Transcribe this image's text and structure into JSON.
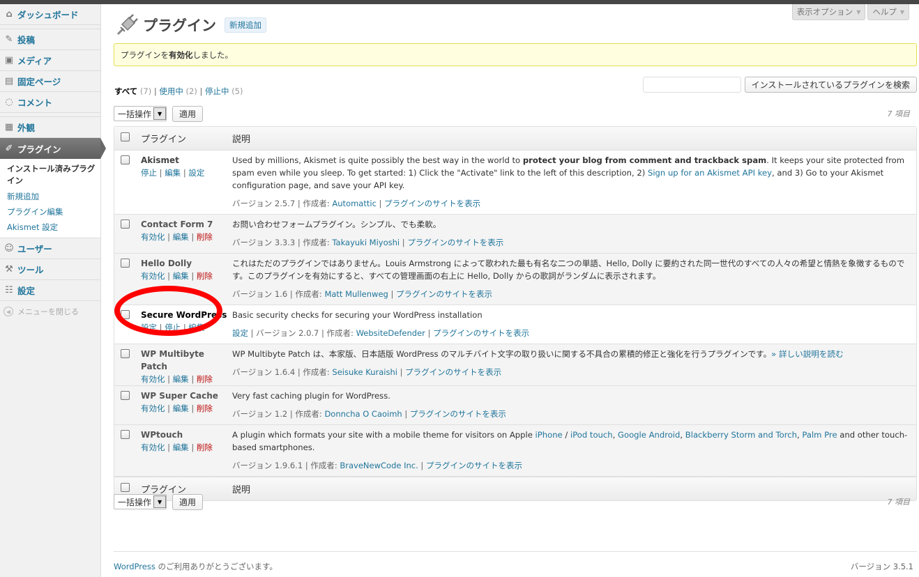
{
  "sidebar": {
    "dashboard": "ダッシュボード",
    "posts": "投稿",
    "media": "メディア",
    "pages": "固定ページ",
    "comments": "コメント",
    "appearance": "外観",
    "plugins": "プラグイン",
    "submenu": [
      "インストール済みプラグイン",
      "新規追加",
      "プラグイン編集",
      "Akismet 設定"
    ],
    "users": "ユーザー",
    "tools": "ツール",
    "settings": "設定",
    "collapse": "メニューを閉じる"
  },
  "screen_options": "表示オプション",
  "help": "ヘルプ",
  "page_title": "プラグイン",
  "add_new": "新規追加",
  "notice": {
    "pre": "プラグインを",
    "bold": "有効化",
    "post": "しました。"
  },
  "filters": {
    "all": "すべて",
    "all_count": "(7)",
    "active": "使用中",
    "active_count": "(2)",
    "inactive": "停止中",
    "inactive_count": "(5)"
  },
  "search_button": "インストールされているプラグインを検索",
  "bulk_actions": "一括操作",
  "apply": "適用",
  "items_count": "7 項目",
  "table": {
    "col_plugin": "プラグイン",
    "col_desc": "説明"
  },
  "plugins": [
    {
      "name": "Akismet",
      "actions": [
        "停止",
        "編集",
        "設定"
      ],
      "desc_1": "Used by millions, Akismet is quite possibly the best way in the world to ",
      "desc_bold": "protect your blog from comment and trackback spam",
      "desc_2": ". It keeps your site protected from spam even while you sleep. To get started: 1) Click the \"Activate\" link to the left of this description, 2) ",
      "desc_link": "Sign up for an Akismet API key",
      "desc_3": ", and 3) Go to your Akismet configuration page, and save your API key.",
      "version": "バージョン 2.5.7 | 作成者: ",
      "author": "Automattic",
      "site_link": "プラグインのサイトを表示"
    },
    {
      "name": "Contact Form 7",
      "actions": [
        "有効化",
        "編集",
        "削除"
      ],
      "desc": "お問い合わせフォームプラグイン。シンプル、でも柔軟。",
      "version": "バージョン 3.3.3 | 作成者: ",
      "author": "Takayuki Miyoshi",
      "site_link": "プラグインのサイトを表示"
    },
    {
      "name": "Hello Dolly",
      "actions": [
        "有効化",
        "編集",
        "削除"
      ],
      "desc": "これはただのプラグインではありません。Louis Armstrong によって歌われた最も有名な二つの単語、Hello, Dolly に要約された同一世代のすべての人々の希望と情熱を象徴するものです。このプラグインを有効にすると、すべての管理画面の右上に Hello, Dolly からの歌詞がランダムに表示されます。",
      "version": "バージョン 1.6 | 作成者: ",
      "author": "Matt Mullenweg",
      "site_link": "プラグインのサイトを表示"
    },
    {
      "name": "Secure WordPress",
      "actions": [
        "設定",
        "停止",
        "編集"
      ],
      "desc": "Basic security checks for securing your WordPress installation",
      "settings_link": "設定",
      "version": " | バージョン 2.0.7 | 作成者: ",
      "author": "WebsiteDefender",
      "site_link": "プラグインのサイトを表示"
    },
    {
      "name": "WP Multibyte Patch",
      "actions": [
        "有効化",
        "編集",
        "削除"
      ],
      "desc": "WP Multibyte Patch は、本家版、日本語版 WordPress のマルチバイト文字の取り扱いに関する不具合の累積的修正と強化を行うプラグインです。",
      "desc_link": "» 詳しい説明を読む",
      "version": "バージョン 1.6.4 | 作成者: ",
      "author": "Seisuke Kuraishi",
      "site_link": "プラグインのサイトを表示"
    },
    {
      "name": "WP Super Cache",
      "actions": [
        "有効化",
        "編集",
        "削除"
      ],
      "desc": "Very fast caching plugin for WordPress.",
      "version": "バージョン 1.2 | 作成者: ",
      "author": "Donncha O Caoimh",
      "site_link": "プラグインのサイトを表示"
    },
    {
      "name": "WPtouch",
      "actions": [
        "有効化",
        "編集",
        "削除"
      ],
      "desc_1": "A plugin which formats your site with a mobile theme for visitors on Apple ",
      "link_iphone": "iPhone",
      "sep": " / ",
      "link_ipod": "iPod touch",
      "comma": ", ",
      "link_android": "Google Android",
      "link_blackberry": "Blackberry Storm and Torch",
      "link_palm": "Palm Pre",
      "desc_2": " and other touch-based smartphones.",
      "version": "バージョン 1.9.6.1 | 作成者: ",
      "author": "BraveNewCode Inc.",
      "site_link": "プラグインのサイトを表示"
    }
  ],
  "footer": {
    "link": "WordPress",
    "text": " のご利用ありがとうございます。",
    "version": "バージョン 3.5.1"
  },
  "colors": {
    "link": "#21759b",
    "delete": "#bc0b0b",
    "notice_bg": "#ffffe0",
    "annotation": "#ff0000"
  }
}
